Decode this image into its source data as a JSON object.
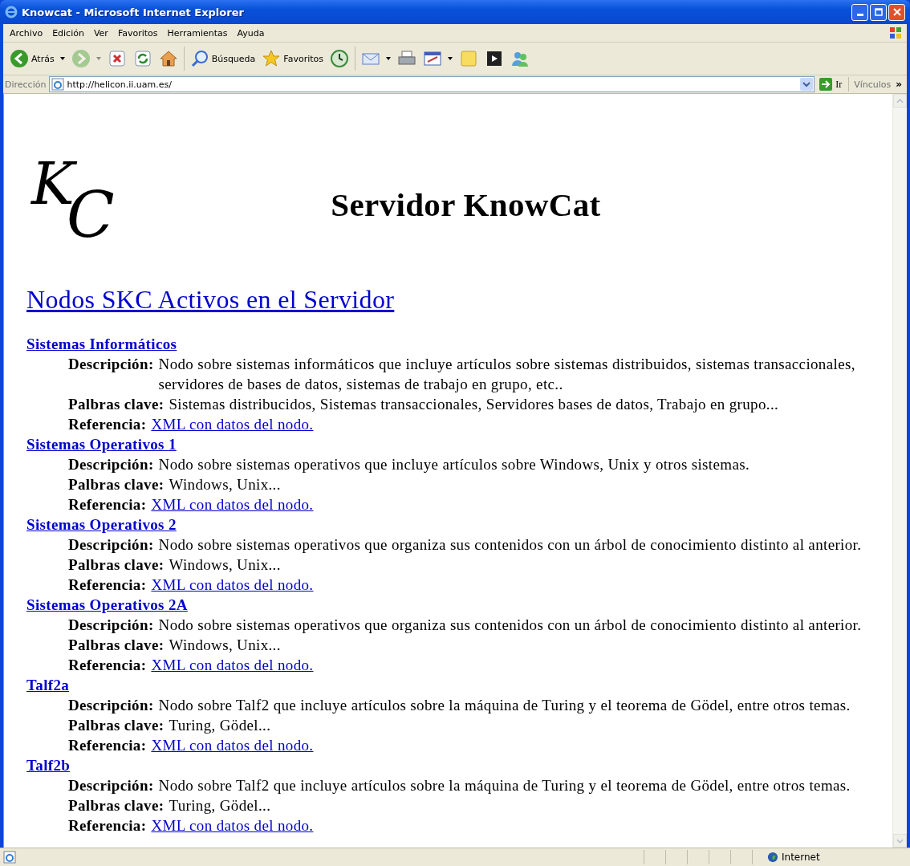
{
  "window": {
    "title": "Knowcat - Microsoft Internet Explorer"
  },
  "menu": [
    "Archivo",
    "Edición",
    "Ver",
    "Favoritos",
    "Herramientas",
    "Ayuda"
  ],
  "toolbar": [
    {
      "kind": "back",
      "label": "Atrás",
      "disabled": false
    },
    {
      "kind": "forward",
      "disabled": true
    },
    {
      "kind": "stop",
      "disabled": false
    },
    {
      "kind": "refresh",
      "disabled": false
    },
    {
      "kind": "home",
      "disabled": false
    },
    {
      "kind": "search",
      "label": "Búsqueda",
      "disabled": false
    },
    {
      "kind": "favorites",
      "label": "Favoritos",
      "disabled": false
    },
    {
      "kind": "history",
      "disabled": false
    },
    {
      "kind": "mail",
      "disabled": false
    },
    {
      "kind": "print",
      "disabled": false
    },
    {
      "kind": "edit",
      "disabled": false
    },
    {
      "kind": "note",
      "disabled": false
    },
    {
      "kind": "media",
      "disabled": false
    },
    {
      "kind": "messenger",
      "disabled": false
    }
  ],
  "address": {
    "label": "Dirección",
    "value": "http://helicon.ii.uam.es/",
    "go": "Ir",
    "links": "Vínculos",
    "more": "»"
  },
  "page": {
    "logo": [
      "K",
      "C"
    ],
    "title": "Servidor KnowCat",
    "heading": "Nodos SKC Activos en el Servidor",
    "nodes": [
      {
        "name": "Sistemas Informáticos",
        "fields": [
          {
            "kind": "text",
            "label": "Descripción:",
            "value": "Nodo sobre sistemas informáticos que incluye artículos sobre sistemas distribuidos, sistemas transaccionales, servidores de bases de datos, sistemas de trabajo en grupo, etc.."
          },
          {
            "kind": "text",
            "label": "Palbras clave:",
            "value": "Sistemas distribucidos, Sistemas transaccionales, Servidores bases de datos, Trabajo en grupo..."
          },
          {
            "kind": "link",
            "label": "Referencia:",
            "value": "XML con datos del nodo."
          }
        ]
      },
      {
        "name": "Sistemas Operativos 1",
        "fields": [
          {
            "kind": "text",
            "label": "Descripción:",
            "value": "Nodo sobre sistemas operativos que incluye artículos sobre Windows, Unix y otros sistemas."
          },
          {
            "kind": "text",
            "label": "Palbras clave:",
            "value": "Windows, Unix..."
          },
          {
            "kind": "link",
            "label": "Referencia:",
            "value": "XML con datos del nodo."
          }
        ]
      },
      {
        "name": "Sistemas Operativos 2",
        "fields": [
          {
            "kind": "text",
            "label": "Descripción:",
            "value": "Nodo sobre sistemas operativos que organiza sus contenidos con un árbol de conocimiento distinto al anterior."
          },
          {
            "kind": "text",
            "label": "Palbras clave:",
            "value": "Windows, Unix..."
          },
          {
            "kind": "link",
            "label": "Referencia:",
            "value": "XML con datos del nodo."
          }
        ]
      },
      {
        "name": "Sistemas Operativos 2A",
        "fields": [
          {
            "kind": "text",
            "label": "Descripción:",
            "value": "Nodo sobre sistemas operativos que organiza sus contenidos con un árbol de conocimiento distinto al anterior."
          },
          {
            "kind": "text",
            "label": "Palbras clave:",
            "value": "Windows, Unix..."
          },
          {
            "kind": "link",
            "label": "Referencia:",
            "value": "XML con datos del nodo."
          }
        ]
      },
      {
        "name": "Talf2a",
        "fields": [
          {
            "kind": "text",
            "label": "Descripción:",
            "value": "Nodo sobre Talf2 que incluye artículos sobre la máquina de Turing y el teorema de Gödel, entre otros temas."
          },
          {
            "kind": "text",
            "label": "Palbras clave:",
            "value": "Turing, Gödel..."
          },
          {
            "kind": "link",
            "label": "Referencia:",
            "value": "XML con datos del nodo."
          }
        ]
      },
      {
        "name": "Talf2b",
        "fields": [
          {
            "kind": "text",
            "label": "Descripción:",
            "value": "Nodo sobre Talf2 que incluye artículos sobre la máquina de Turing y el teorema de Gödel, entre otros temas."
          },
          {
            "kind": "text",
            "label": "Palbras clave:",
            "value": "Turing, Gödel..."
          },
          {
            "kind": "link",
            "label": "Referencia:",
            "value": "XML con datos del nodo."
          }
        ]
      }
    ]
  },
  "status_bar": {
    "zone": "Internet"
  }
}
